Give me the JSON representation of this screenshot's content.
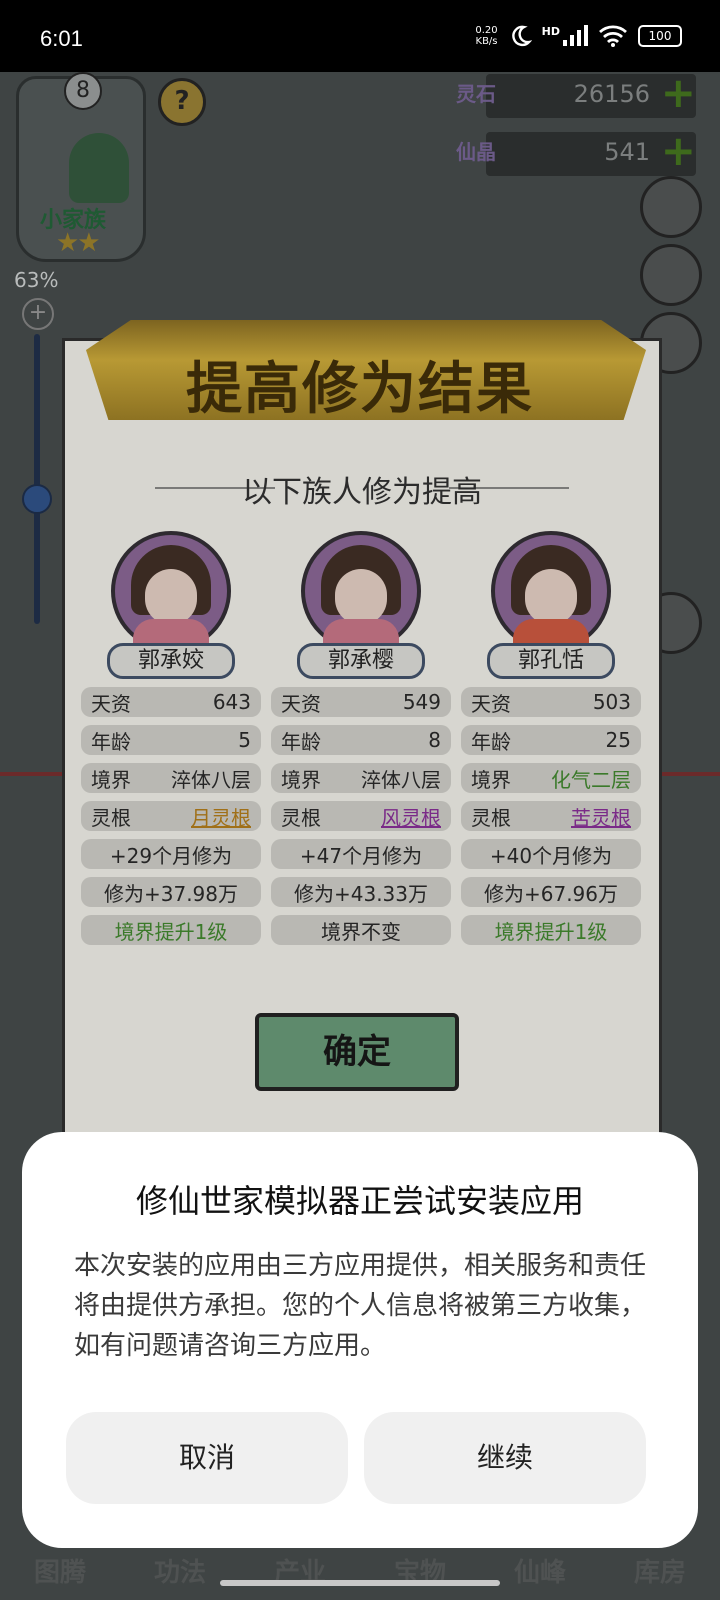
{
  "status_bar": {
    "time": "6:01",
    "speed_value": "0.20",
    "speed_unit": "KB/s",
    "network": "HD",
    "battery": "100"
  },
  "hud": {
    "family_level": "8",
    "help": "?",
    "family_name": "小家族",
    "stars": "★★",
    "zoom_percent": "63%",
    "zoom_plus": "+",
    "lingshi_label": "灵石",
    "lingshi_value": "26156",
    "xianjing_label": "仙晶",
    "xianjing_value": "541",
    "plus": "+"
  },
  "bottom_nav": [
    "图腾",
    "功法",
    "产业",
    "宝物",
    "仙峰",
    "库房"
  ],
  "result_panel": {
    "title": "提高修为结果",
    "subtitle": "以下族人修为提高",
    "confirm_label": "确定",
    "members": [
      {
        "name": "郭承姣",
        "talent_label": "天资",
        "talent_value": "643",
        "age_label": "年龄",
        "age_value": "5",
        "realm_label": "境界",
        "realm_value": "淬体八层",
        "root_label": "灵根",
        "root_value": "月灵根",
        "months": "+29个月修为",
        "cultivation": "修为+37.98万",
        "result": "境界提升1级"
      },
      {
        "name": "郭承樱",
        "talent_label": "天资",
        "talent_value": "549",
        "age_label": "年龄",
        "age_value": "8",
        "realm_label": "境界",
        "realm_value": "淬体八层",
        "root_label": "灵根",
        "root_value": "风灵根",
        "months": "+47个月修为",
        "cultivation": "修为+43.33万",
        "result": "境界不变"
      },
      {
        "name": "郭孔恬",
        "talent_label": "天资",
        "talent_value": "503",
        "age_label": "年龄",
        "age_value": "25",
        "realm_label": "境界",
        "realm_value": "化气二层",
        "root_label": "灵根",
        "root_value": "苦灵根",
        "months": "+40个月修为",
        "cultivation": "修为+67.96万",
        "result": "境界提升1级"
      }
    ]
  },
  "dialog": {
    "title": "修仙世家模拟器正尝试安装应用",
    "body": "本次安装的应用由三方应用提供，相关服务和责任将由提供方承担。您的个人信息将被第三方收集，如有问题请咨询三方应用。",
    "cancel_label": "取消",
    "continue_label": "继续"
  }
}
